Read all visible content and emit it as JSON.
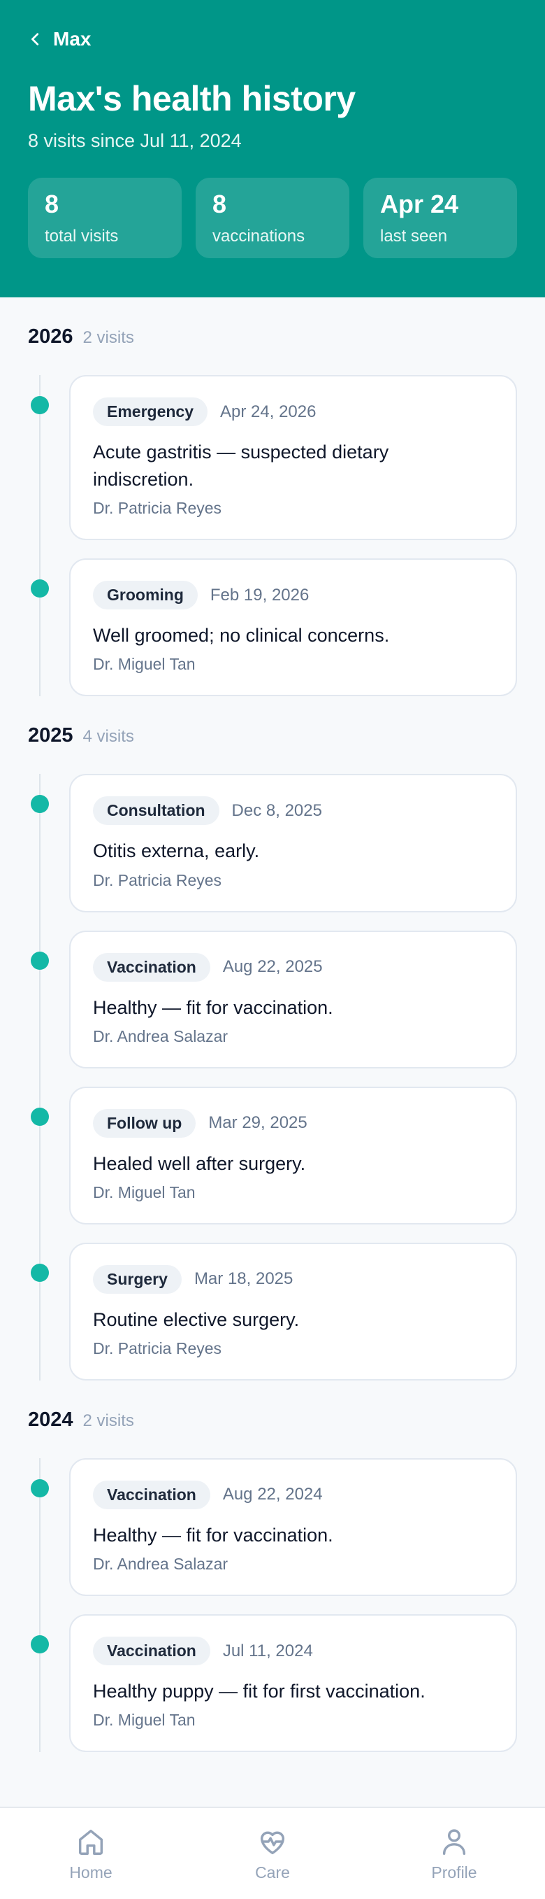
{
  "header": {
    "back_label": "Max",
    "title": "Max's health history",
    "subtitle": "8 visits since Jul 11, 2024",
    "stats": [
      {
        "value": "8",
        "label": "total visits"
      },
      {
        "value": "8",
        "label": "vaccinations"
      },
      {
        "value": "Apr 24",
        "label": "last seen"
      }
    ]
  },
  "colors": {
    "header_bg": "#009688",
    "timeline_dot": "#14b8a6",
    "tag_bg": "#eef2f6"
  },
  "years": [
    {
      "year": "2026",
      "count": "2 visits",
      "visits": [
        {
          "type": "Emergency",
          "date": "Apr 24, 2026",
          "diagnosis": "Acute gastritis — suspected dietary indiscretion.",
          "doctor": "Dr. Patricia Reyes"
        },
        {
          "type": "Grooming",
          "date": "Feb 19, 2026",
          "diagnosis": "Well groomed; no clinical concerns.",
          "doctor": "Dr. Miguel Tan"
        }
      ]
    },
    {
      "year": "2025",
      "count": "4 visits",
      "visits": [
        {
          "type": "Consultation",
          "date": "Dec 8, 2025",
          "diagnosis": "Otitis externa, early.",
          "doctor": "Dr. Patricia Reyes"
        },
        {
          "type": "Vaccination",
          "date": "Aug 22, 2025",
          "diagnosis": "Healthy — fit for vaccination.",
          "doctor": "Dr. Andrea Salazar"
        },
        {
          "type": "Follow up",
          "date": "Mar 29, 2025",
          "diagnosis": "Healed well after surgery.",
          "doctor": "Dr. Miguel Tan"
        },
        {
          "type": "Surgery",
          "date": "Mar 18, 2025",
          "diagnosis": "Routine elective surgery.",
          "doctor": "Dr. Patricia Reyes"
        }
      ]
    },
    {
      "year": "2024",
      "count": "2 visits",
      "visits": [
        {
          "type": "Vaccination",
          "date": "Aug 22, 2024",
          "diagnosis": "Healthy — fit for vaccination.",
          "doctor": "Dr. Andrea Salazar"
        },
        {
          "type": "Vaccination",
          "date": "Jul 11, 2024",
          "diagnosis": "Healthy puppy — fit for first vaccination.",
          "doctor": "Dr. Miguel Tan"
        }
      ]
    }
  ],
  "nav": {
    "items": [
      {
        "label": "Home",
        "icon": "home-icon"
      },
      {
        "label": "Care",
        "icon": "heart-pulse-icon"
      },
      {
        "label": "Profile",
        "icon": "user-icon"
      }
    ]
  }
}
